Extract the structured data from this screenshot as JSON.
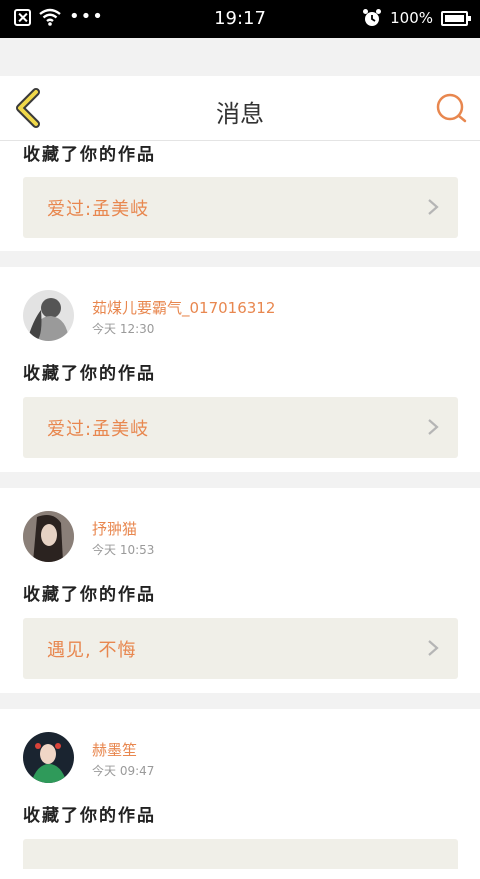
{
  "status_bar": {
    "time": "19:17",
    "battery": "100%"
  },
  "header": {
    "title": "消息"
  },
  "cards": [
    {
      "action": "收藏了你的作品",
      "work_title": "爱过:孟美岐"
    },
    {
      "username": "茹煤儿要霸气_017016312",
      "time": "今天 12:30",
      "action": "收藏了你的作品",
      "work_title": "爱过:孟美岐"
    },
    {
      "username": "抒翀猫",
      "time": "今天 10:53",
      "action": "收藏了你的作品",
      "work_title": "遇见, 不悔"
    },
    {
      "username": "赫墨笙",
      "time": "今天 09:47",
      "action": "收藏了你的作品"
    }
  ],
  "colors": {
    "accent": "#e8874f",
    "back_arrow": "#f0d84a",
    "card_bg": "#ffffff",
    "link_bg": "#f0efe8"
  }
}
